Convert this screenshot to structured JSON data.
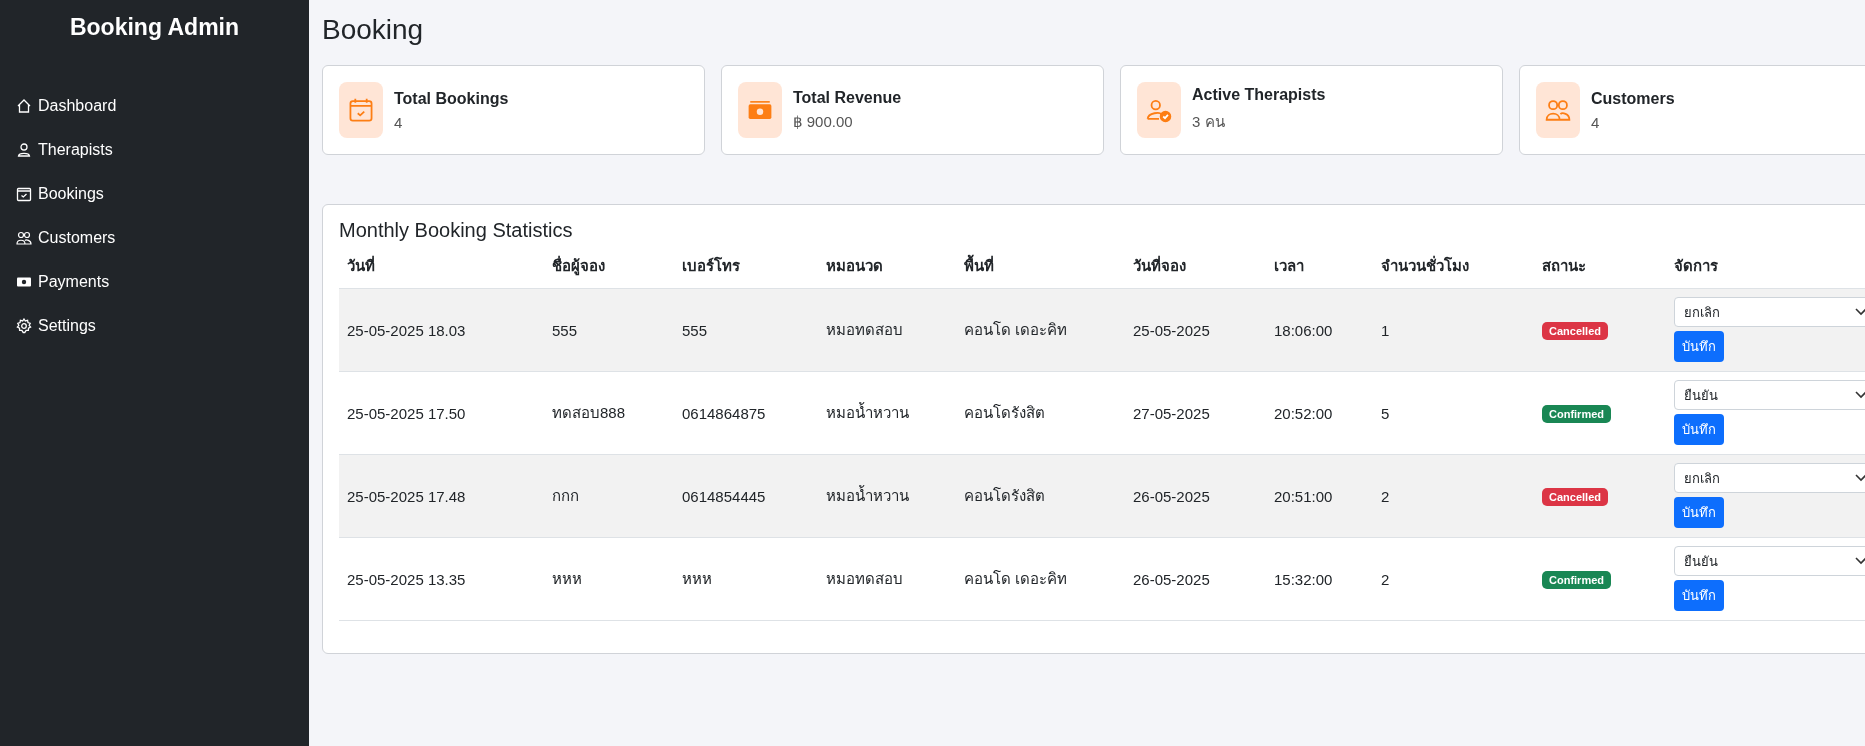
{
  "sidebar": {
    "title": "Booking Admin",
    "items": [
      {
        "label": "Dashboard"
      },
      {
        "label": "Therapists"
      },
      {
        "label": "Bookings"
      },
      {
        "label": "Customers"
      },
      {
        "label": "Payments"
      },
      {
        "label": "Settings"
      }
    ]
  },
  "page_title": "Booking",
  "stats": [
    {
      "label": "Total Bookings",
      "value": "4"
    },
    {
      "label": "Total Revenue",
      "value": "฿ 900.00"
    },
    {
      "label": "Active Therapists",
      "value": "3 คน"
    },
    {
      "label": "Customers",
      "value": "4"
    }
  ],
  "table": {
    "title": "Monthly Booking Statistics",
    "columns": [
      "วันที่",
      "ชื่อผู้จอง",
      "เบอร์โทร",
      "หมอนวด",
      "พื้นที่",
      "วันที่จอง",
      "เวลา",
      "จำนวนชั่วโมง",
      "สถานะ",
      "จัดการ"
    ],
    "rows": [
      {
        "cells": [
          "25-05-2025 18.03",
          "555",
          "555",
          "หมอทดสอบ",
          "คอนโด เดอะคิท",
          "25-05-2025",
          "18:06:00",
          "1"
        ],
        "status": {
          "label": "Cancelled",
          "kind": "cancelled"
        },
        "action": {
          "value": "ยกเลิก",
          "button": "บันทึก"
        }
      },
      {
        "cells": [
          "25-05-2025 17.50",
          "ทดสอบ888",
          "0614864875",
          "หมอน้ำหวาน",
          "คอนโดรังสิต",
          "27-05-2025",
          "20:52:00",
          "5"
        ],
        "status": {
          "label": "Confirmed",
          "kind": "confirmed"
        },
        "action": {
          "value": "ยืนยัน",
          "button": "บันทึก"
        }
      },
      {
        "cells": [
          "25-05-2025 17.48",
          "กกก",
          "0614854445",
          "หมอน้ำหวาน",
          "คอนโดรังสิต",
          "26-05-2025",
          "20:51:00",
          "2"
        ],
        "status": {
          "label": "Cancelled",
          "kind": "cancelled"
        },
        "action": {
          "value": "ยกเลิก",
          "button": "บันทึก"
        }
      },
      {
        "cells": [
          "25-05-2025 13.35",
          "หหห",
          "หหห",
          "หมอทดสอบ",
          "คอนโด เดอะคิท",
          "26-05-2025",
          "15:32:00",
          "2"
        ],
        "status": {
          "label": "Confirmed",
          "kind": "confirmed"
        },
        "action": {
          "value": "ยืนยัน",
          "button": "บันทึก"
        }
      }
    ]
  }
}
